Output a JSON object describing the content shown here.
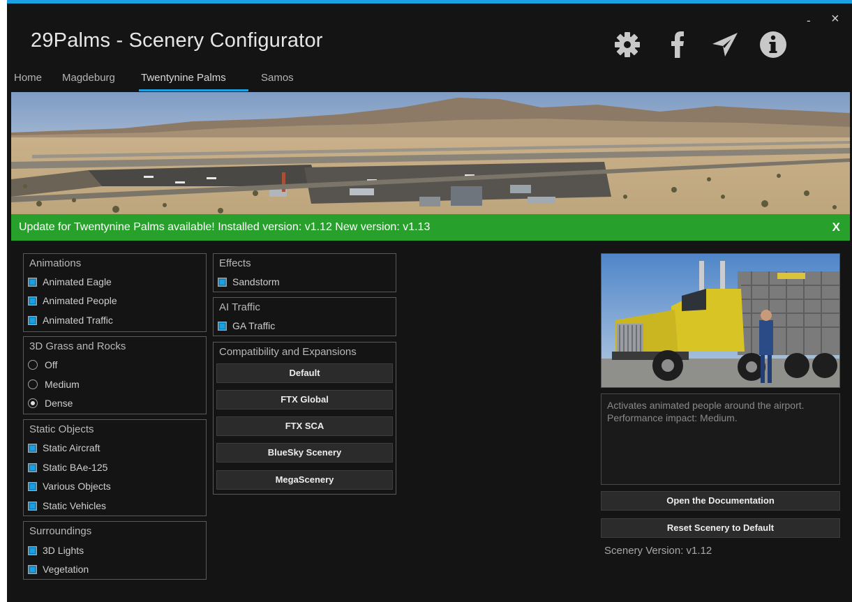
{
  "window": {
    "title": "29Palms - Scenery Configurator",
    "minimize_label": "-",
    "close_label": "×",
    "accent_color": "#1ba1e2",
    "background_color": "#141414"
  },
  "top_icons": [
    "gear-icon",
    "facebook-icon",
    "paper-plane-icon",
    "info-icon"
  ],
  "tabs": [
    {
      "label": "Home"
    },
    {
      "label": "Magdeburg"
    },
    {
      "label": "Twentynine Palms",
      "active": true
    },
    {
      "label": "Samos"
    }
  ],
  "update_bar": {
    "text": "Update for Twentynine Palms available! Installed version: v1.12 New version: v1.13",
    "close_label": "X",
    "color": "#27a12b"
  },
  "groups": {
    "animations": {
      "title": "Animations",
      "items": [
        {
          "label": "Animated Eagle",
          "checked": true
        },
        {
          "label": "Animated People",
          "checked": true
        },
        {
          "label": "Animated Traffic",
          "checked": true
        }
      ]
    },
    "grass": {
      "title": "3D Grass and Rocks",
      "options": [
        {
          "label": "Off",
          "selected": false
        },
        {
          "label": "Medium",
          "selected": false
        },
        {
          "label": "Dense",
          "selected": true
        }
      ]
    },
    "static_objects": {
      "title": "Static Objects",
      "items": [
        {
          "label": "Static Aircraft",
          "checked": true
        },
        {
          "label": "Static BAe-125",
          "checked": true
        },
        {
          "label": "Various Objects",
          "checked": true
        },
        {
          "label": "Static Vehicles",
          "checked": true
        }
      ]
    },
    "surroundings": {
      "title": "Surroundings",
      "items": [
        {
          "label": "3D Lights",
          "checked": true
        },
        {
          "label": "Vegetation",
          "checked": true
        }
      ]
    },
    "effects": {
      "title": "Effects",
      "items": [
        {
          "label": "Sandstorm",
          "checked": true
        }
      ]
    },
    "ai_traffic": {
      "title": "AI Traffic",
      "items": [
        {
          "label": "GA Traffic",
          "checked": true
        }
      ]
    },
    "compat": {
      "title": "Compatibility and Expansions",
      "buttons": [
        "Default",
        "FTX Global",
        "FTX SCA",
        "BlueSky Scenery",
        "MegaScenery"
      ]
    }
  },
  "right_panel": {
    "description": "Activates animated people around the airport. Performance impact: Medium.",
    "open_docs_label": "Open the Documentation",
    "reset_label": "Reset Scenery to Default",
    "version_text": "Scenery Version: v1.12"
  }
}
